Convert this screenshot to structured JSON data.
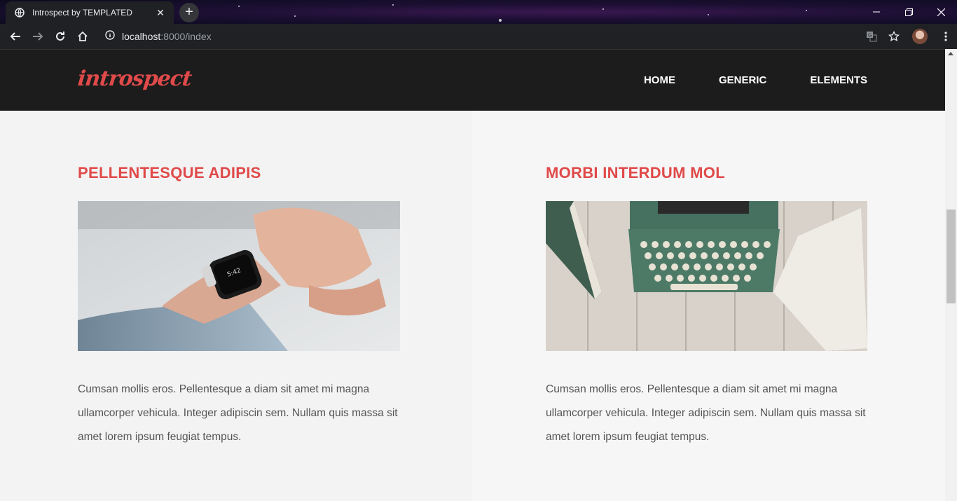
{
  "browser": {
    "tab_title": "Introspect by TEMPLATED",
    "url_host": "localhost",
    "url_path": ":8000/index"
  },
  "site": {
    "logo": "introspect",
    "nav": [
      "HOME",
      "GENERIC",
      "ELEMENTS"
    ]
  },
  "features": [
    {
      "title": "PELLENTESQUE ADIPIS",
      "image": "smartwatch-on-wrist",
      "text": "Cumsan mollis eros. Pellentesque a diam sit amet mi magna ullamcorper vehicula. Integer adipiscin sem. Nullam quis massa sit amet lorem ipsum feugiat tempus."
    },
    {
      "title": "MORBI INTERDUM MOL",
      "image": "typewriter-on-wooden-desk",
      "text": "Cumsan mollis eros. Pellentesque a diam sit amet mi magna ullamcorper vehicula. Integer adipiscin sem. Nullam quis massa sit amet lorem ipsum feugiat tempus."
    }
  ],
  "colors": {
    "accent": "#e04a4a",
    "header_bg": "#1c1c1c",
    "chrome_bg": "#202124"
  }
}
